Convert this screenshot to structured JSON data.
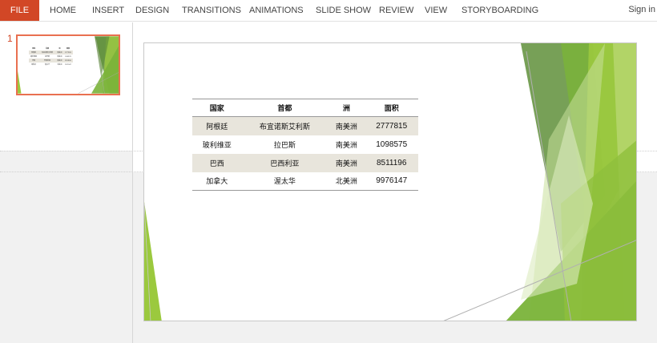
{
  "ribbon": {
    "file": "FILE",
    "tabs": [
      "HOME",
      "INSERT",
      "DESIGN",
      "TRANSITIONS",
      "ANIMATIONS",
      "SLIDE SHOW",
      "REVIEW",
      "VIEW",
      "STORYBOARDING"
    ],
    "sign_in": "Sign in"
  },
  "thumbnails": {
    "slide_number": "1"
  },
  "slide": {
    "table": {
      "headers": [
        "国家",
        "首都",
        "洲",
        "面积"
      ],
      "rows": [
        [
          "阿根廷",
          "布宜诺斯艾利斯",
          "南美洲",
          "2777815"
        ],
        [
          "玻利维亚",
          "拉巴斯",
          "南美洲",
          "1098575"
        ],
        [
          "巴西",
          "巴西利亚",
          "南美洲",
          "8511196"
        ],
        [
          "加拿大",
          "渥太华",
          "北美洲",
          "9976147"
        ]
      ]
    },
    "colors": {
      "dark_green": "#5f8f3a",
      "mid_green": "#7ab33a",
      "light_green": "#9bc93e",
      "pale_green": "#c8e09a",
      "table_shade": "#e8e5dc"
    }
  },
  "accent_color": "#d24726"
}
